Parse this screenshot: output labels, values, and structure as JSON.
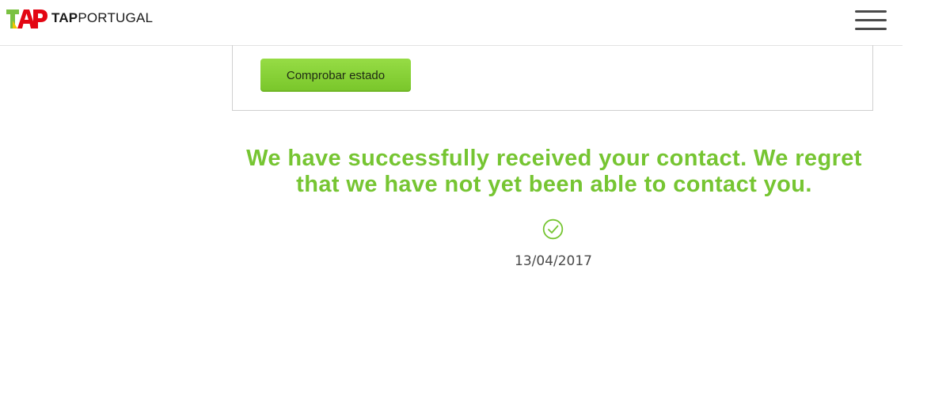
{
  "header": {
    "brand_bold": "TAP",
    "brand_rest": "PORTUGAL",
    "brand_colors": {
      "green": "#7ac142",
      "red": "#e30613",
      "yellow": "#f2c500"
    },
    "menu_icon": "hamburger-menu-icon"
  },
  "status_card": {
    "button_label": "Comprobar estado",
    "button_color": "#85d036"
  },
  "confirmation": {
    "message": "We have successfully received your contact. We regret that we have not yet been able to contact you.",
    "message_color": "#76c532",
    "icon": "check-circle-icon",
    "date": "13/04/2017"
  }
}
